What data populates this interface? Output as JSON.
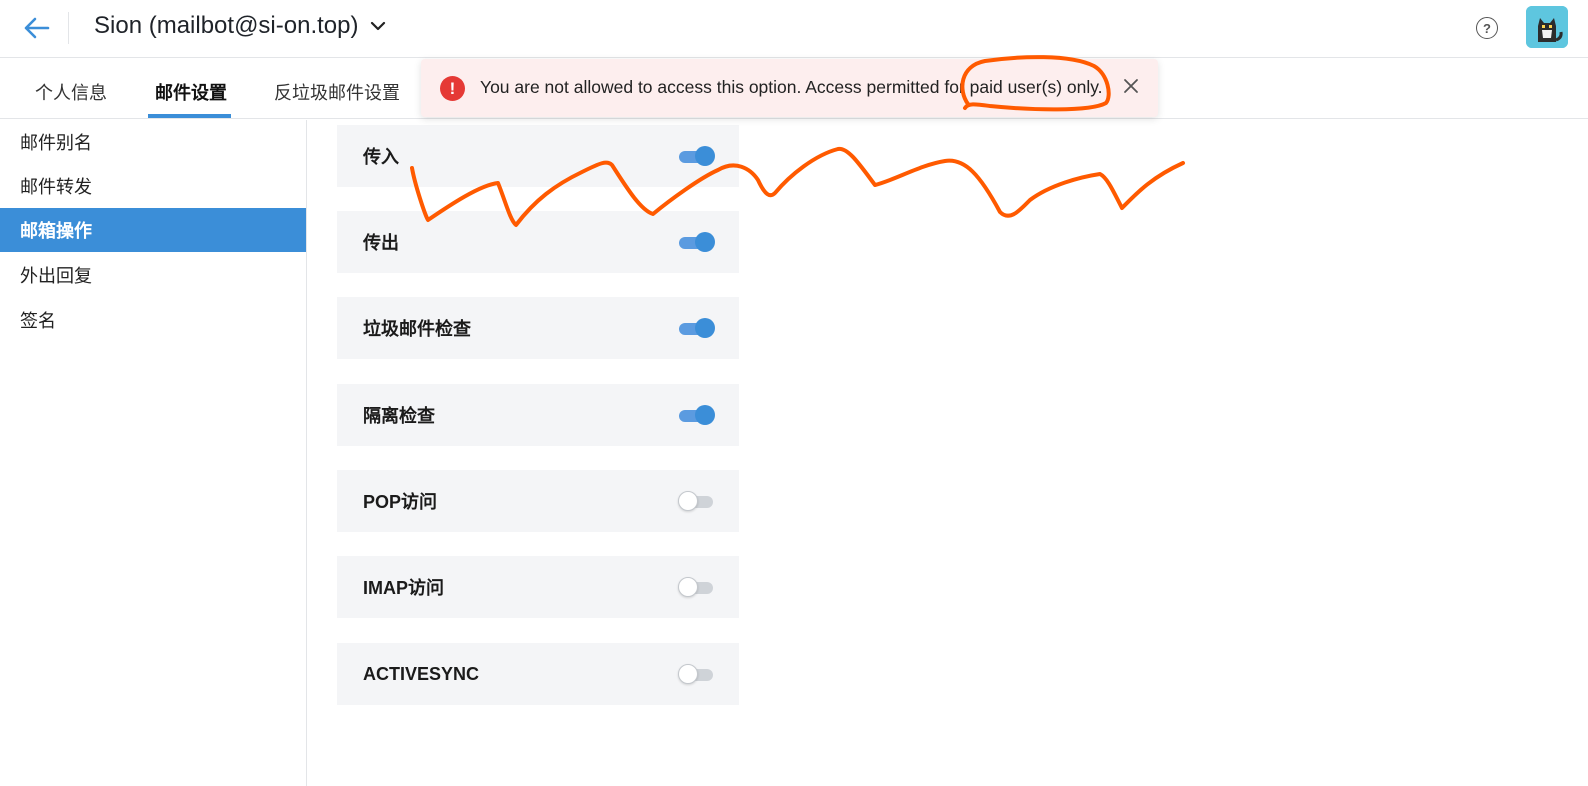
{
  "header": {
    "account_title": "Sion (mailbot@si-on.top)",
    "back_icon": "arrow-left-icon",
    "help_icon": "question-circle-icon",
    "help_glyph": "?",
    "avatar_icon": "cat-avatar-icon"
  },
  "tabs": [
    {
      "label": "个人信息",
      "active": false
    },
    {
      "label": "邮件设置",
      "active": true
    },
    {
      "label": "反垃圾邮件设置",
      "active": false
    }
  ],
  "sidebar": {
    "items": [
      {
        "label": "邮件别名",
        "active": false
      },
      {
        "label": "邮件转发",
        "active": false
      },
      {
        "label": "邮箱操作",
        "active": true
      },
      {
        "label": "外出回复",
        "active": false
      },
      {
        "label": "签名",
        "active": false
      }
    ]
  },
  "settings": {
    "rows": [
      {
        "label": "传入",
        "enabled": true
      },
      {
        "label": "传出",
        "enabled": true
      },
      {
        "label": "垃圾邮件检查",
        "enabled": true
      },
      {
        "label": "隔离检查",
        "enabled": true
      },
      {
        "label": "POP访问",
        "enabled": false
      },
      {
        "label": "IMAP访问",
        "enabled": false
      },
      {
        "label": "ACTIVESYNC",
        "enabled": false
      }
    ]
  },
  "alert": {
    "icon": "error-exclamation-icon",
    "icon_glyph": "!",
    "message": "You are not allowed to access this option. Access permitted for paid user(s) only.",
    "close_icon": "close-icon"
  },
  "colors": {
    "accent": "#3b8ed8",
    "alert_bg": "#fdeeee",
    "alert_icon": "#e53935",
    "annotation": "#ff5a00",
    "row_bg": "#f4f5f7"
  }
}
